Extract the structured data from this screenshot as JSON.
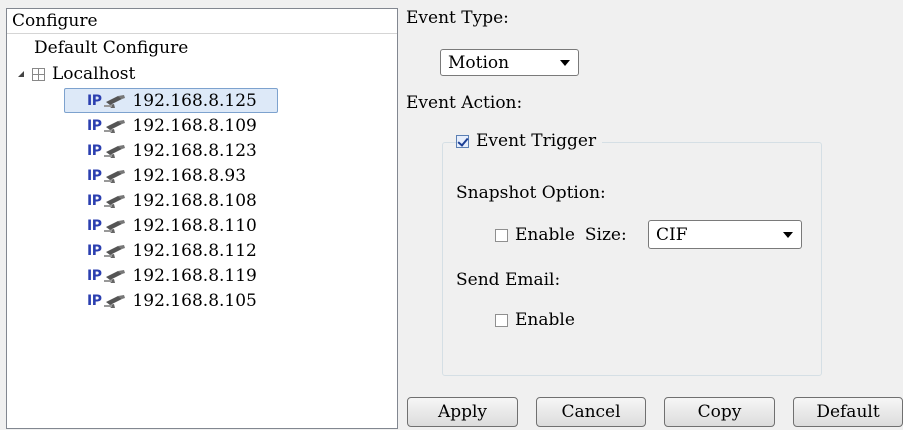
{
  "tree": {
    "header": "Configure",
    "root": "Default Configure",
    "node": "Localhost",
    "ip_tag": "IP",
    "cameras": [
      {
        "ip": "192.168.8.125"
      },
      {
        "ip": "192.168.8.109"
      },
      {
        "ip": "192.168.8.123"
      },
      {
        "ip": "192.168.8.93"
      },
      {
        "ip": "192.168.8.108"
      },
      {
        "ip": "192.168.8.110"
      },
      {
        "ip": "192.168.8.112"
      },
      {
        "ip": "192.168.8.119"
      },
      {
        "ip": "192.168.8.105"
      }
    ],
    "selected_ip": "192.168.8.125"
  },
  "event": {
    "type_label": "Event Type:",
    "type_value": "Motion",
    "action_label": "Event Action:",
    "trigger_label": "Event Trigger",
    "trigger_checked": true,
    "snapshot_label": "Snapshot Option:",
    "snapshot_enable_label": "Enable",
    "snapshot_enabled": false,
    "size_label": "Size:",
    "size_value": "CIF",
    "email_label": "Send Email:",
    "email_enable_label": "Enable",
    "email_enabled": false
  },
  "buttons": {
    "apply": "Apply",
    "cancel": "Cancel",
    "copy": "Copy",
    "default": "Default"
  },
  "colors": {
    "ip_tag": "#2b3fb0",
    "selection_bg": "#dde9f8",
    "selection_border": "#7da2ce"
  }
}
